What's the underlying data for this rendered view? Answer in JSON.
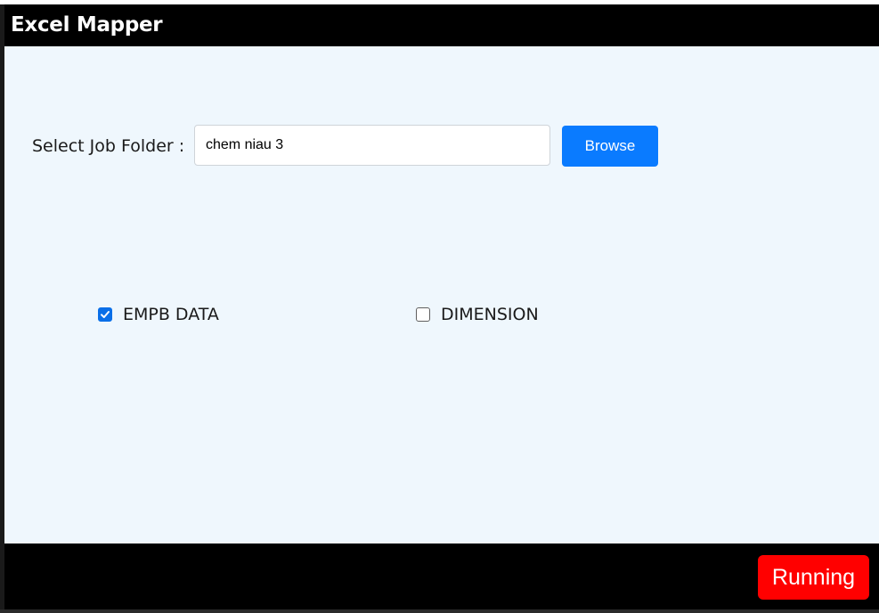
{
  "app": {
    "title": "Excel Mapper"
  },
  "form": {
    "folder_label": "Select Job Folder :",
    "folder_value": "chem niau 3",
    "browse_label": "Browse"
  },
  "options": [
    {
      "label": "EMPB DATA",
      "checked": true
    },
    {
      "label": "DIMENSION",
      "checked": false
    }
  ],
  "footer": {
    "status_label": "Running"
  },
  "colors": {
    "accent": "#0a7bff",
    "status": "#ff0000",
    "content_bg": "#eff7fd",
    "chrome": "#000000"
  },
  "icons": {
    "checkmark": "check-icon"
  }
}
